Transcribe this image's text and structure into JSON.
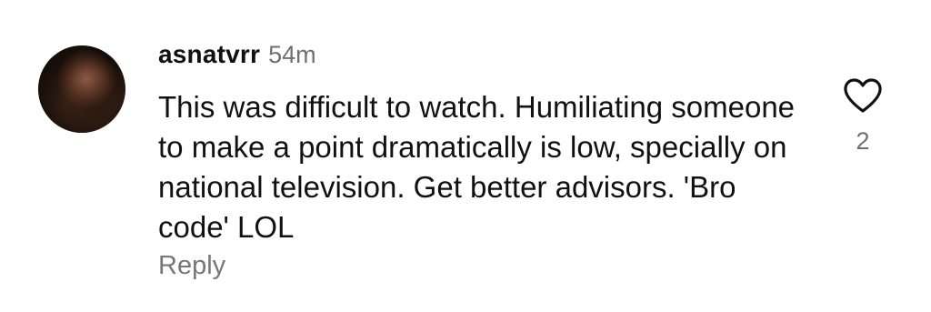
{
  "comment": {
    "username": "asnatvrr",
    "timestamp": "54m",
    "text": "This was difficult to watch. Humiliating someone to make a point dramatically is low, specially on national television. Get better advisors. 'Bro code' LOL",
    "reply_label": "Reply",
    "like_count": "2",
    "like_icon": "heart-outline-icon"
  },
  "colors": {
    "text": "#111111",
    "muted": "#6f6f6f",
    "background": "#ffffff"
  }
}
